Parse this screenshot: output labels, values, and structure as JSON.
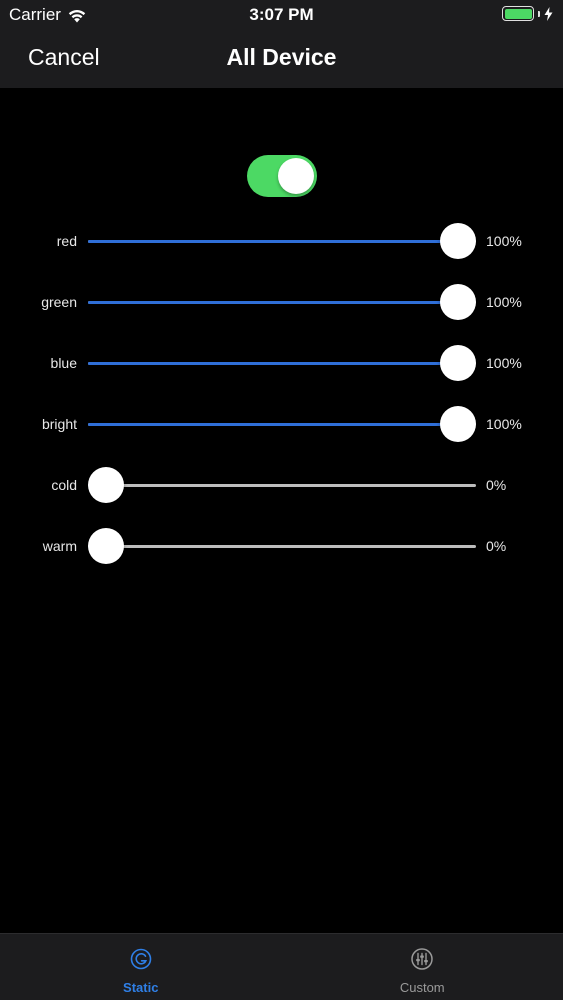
{
  "status_bar": {
    "carrier": "Carrier",
    "time": "3:07 PM",
    "battery_color": "#4cd964"
  },
  "nav": {
    "cancel_label": "Cancel",
    "title": "All Device"
  },
  "power_toggle": {
    "on": true,
    "color": "#4cd964"
  },
  "sliders": [
    {
      "label": "red",
      "value": "100%",
      "level": 100,
      "active_color": "#2f6fd8"
    },
    {
      "label": "green",
      "value": "100%",
      "level": 100,
      "active_color": "#2f6fd8"
    },
    {
      "label": "blue",
      "value": "100%",
      "level": 100,
      "active_color": "#2f6fd8"
    },
    {
      "label": "bright",
      "value": "100%",
      "level": 100,
      "active_color": "#2f6fd8"
    },
    {
      "label": "cold",
      "value": "0%",
      "level": 0,
      "active_color": "#2f6fd8"
    },
    {
      "label": "warm",
      "value": "0%",
      "level": 0,
      "active_color": "#2f6fd8"
    }
  ],
  "tab_bar": {
    "tabs": [
      {
        "label": "Static",
        "icon": "static-icon",
        "active": true,
        "color": "#2f7fe6"
      },
      {
        "label": "Custom",
        "icon": "custom-sliders-icon",
        "active": false,
        "color": "#9a9a9a"
      }
    ]
  }
}
